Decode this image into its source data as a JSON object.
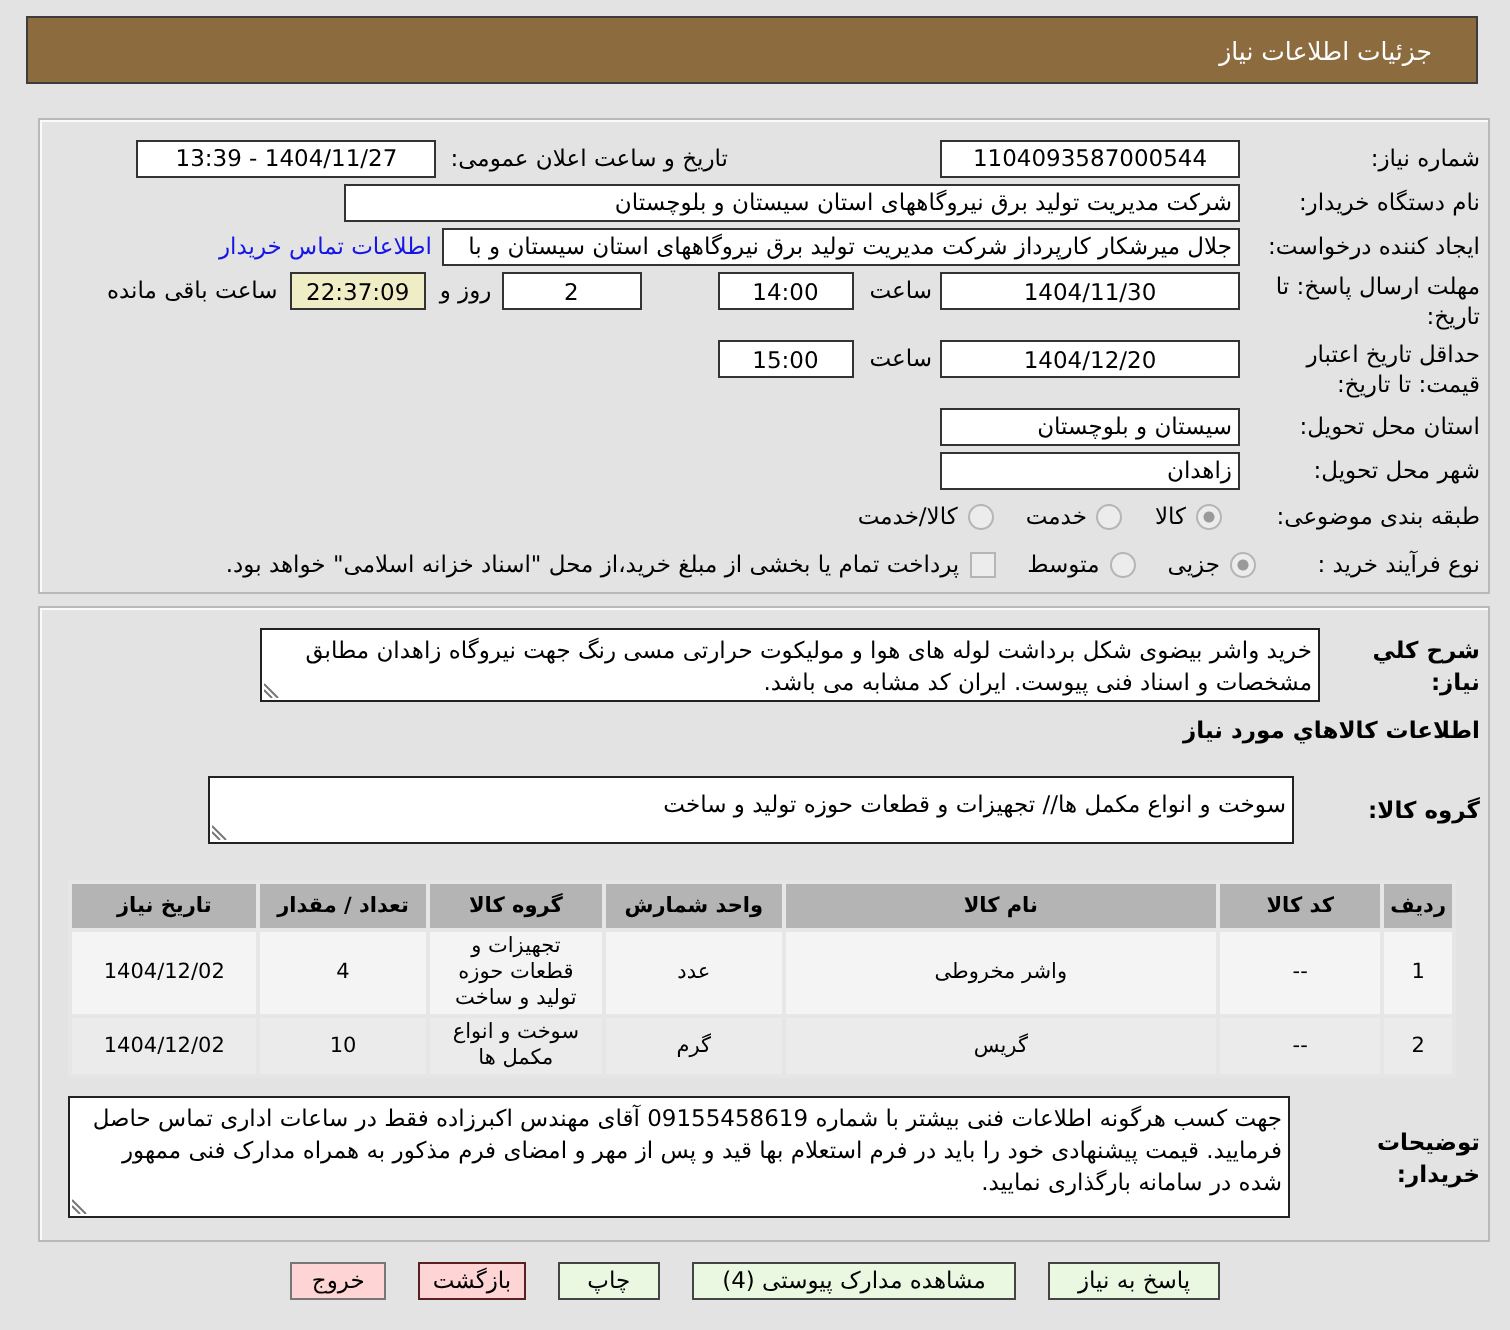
{
  "header": {
    "title": "جزئیات اطلاعات نیاز"
  },
  "details": {
    "need_number": {
      "label": "شماره نیاز:",
      "value": "1104093587000544"
    },
    "announce": {
      "label": "تاریخ و ساعت اعلان عمومی:",
      "value": "1404/11/27 - 13:39"
    },
    "buyer": {
      "label": "نام دستگاه خریدار:",
      "value": "شرکت مدیریت تولید برق نیروگاههای استان سیستان و بلوچستان"
    },
    "requester": {
      "label": "ایجاد کننده درخواست:",
      "value": "جلال میرشکار کارپرداز شرکت مدیریت تولید برق نیروگاههای استان سیستان و با",
      "link": "اطلاعات تماس خریدار"
    },
    "response_deadline": {
      "label": "مهلت ارسال پاسخ: تا تاریخ:",
      "date": "1404/11/30",
      "time_label": "ساعت",
      "time": "14:00",
      "days": "2",
      "days_label": "روز و",
      "remaining": "22:37:09",
      "remaining_label": "ساعت باقی مانده"
    },
    "price_validity": {
      "label": "حداقل تاریخ اعتبار قیمت: تا تاریخ:",
      "date": "1404/12/20",
      "time_label": "ساعت",
      "time": "15:00"
    },
    "province": {
      "label": "استان محل تحویل:",
      "value": "سیستان و بلوچستان"
    },
    "city": {
      "label": "شهر محل تحویل:",
      "value": "زاهدان"
    },
    "category": {
      "label": "طبقه بندی موضوعی:",
      "options": [
        {
          "label": "کالا",
          "selected": true
        },
        {
          "label": "خدمت",
          "selected": false
        },
        {
          "label": "کالا/خدمت",
          "selected": false
        }
      ]
    },
    "purchase_type": {
      "label": "نوع فرآیند خرید :",
      "options": [
        {
          "label": "جزیی",
          "selected": true
        },
        {
          "label": "متوسط",
          "selected": false
        }
      ],
      "treasury": {
        "label": "پرداخت تمام یا بخشی از مبلغ خرید،از محل \"اسناد خزانه اسلامی\" خواهد بود.",
        "checked": false
      }
    }
  },
  "summary": {
    "label": "شرح کلي نياز:",
    "text": "خرید واشر بیضوی شکل برداشت لوله های هوا و مولیکوت حرارتی مسی رنگ جهت نیروگاه زاهدان مطابق مشخصات و اسناد فنی پیوست. ایران کد مشابه می باشد."
  },
  "goods": {
    "heading": "اطلاعات کالاهاي مورد نياز",
    "group_label": "گروه کالا:",
    "group_value": "سوخت و انواع مکمل ها// تجهیزات و قطعات حوزه تولید و ساخت",
    "table": {
      "columns": [
        "ردیف",
        "کد کالا",
        "نام کالا",
        "واحد شمارش",
        "گروه کالا",
        "تعداد / مقدار",
        "تاریخ نیاز"
      ],
      "rows": [
        [
          "1",
          "--",
          "واشر مخروطی",
          "عدد",
          "تجهیزات و قطعات حوزه تولید و ساخت",
          "4",
          "1404/12/02"
        ],
        [
          "2",
          "--",
          "گریس",
          "گرم",
          "سوخت و انواع مکمل ها",
          "10",
          "1404/12/02"
        ]
      ]
    }
  },
  "buyer_notes": {
    "label": "توضیحات خریدار:",
    "text": "جهت کسب هرگونه اطلاعات فنی بیشتر با شماره 09155458619 آقای مهندس اکبرزاده فقط در ساعات اداری تماس حاصل فرمایید. قیمت پیشنهادی خود را باید در فرم استعلام بها قید و پس از مهر و امضای فرم مذکور به همراه مدارک فنی ممهور شده در سامانه بارگذاری نمایید."
  },
  "buttons": [
    {
      "label": "پاسخ به نیاز",
      "kind": "action"
    },
    {
      "label": "مشاهده مدارک پیوستی (4)",
      "kind": "action"
    },
    {
      "label": "چاپ",
      "kind": "action"
    },
    {
      "label": "بازگشت",
      "kind": "back"
    },
    {
      "label": "خروج",
      "kind": "exit"
    }
  ]
}
